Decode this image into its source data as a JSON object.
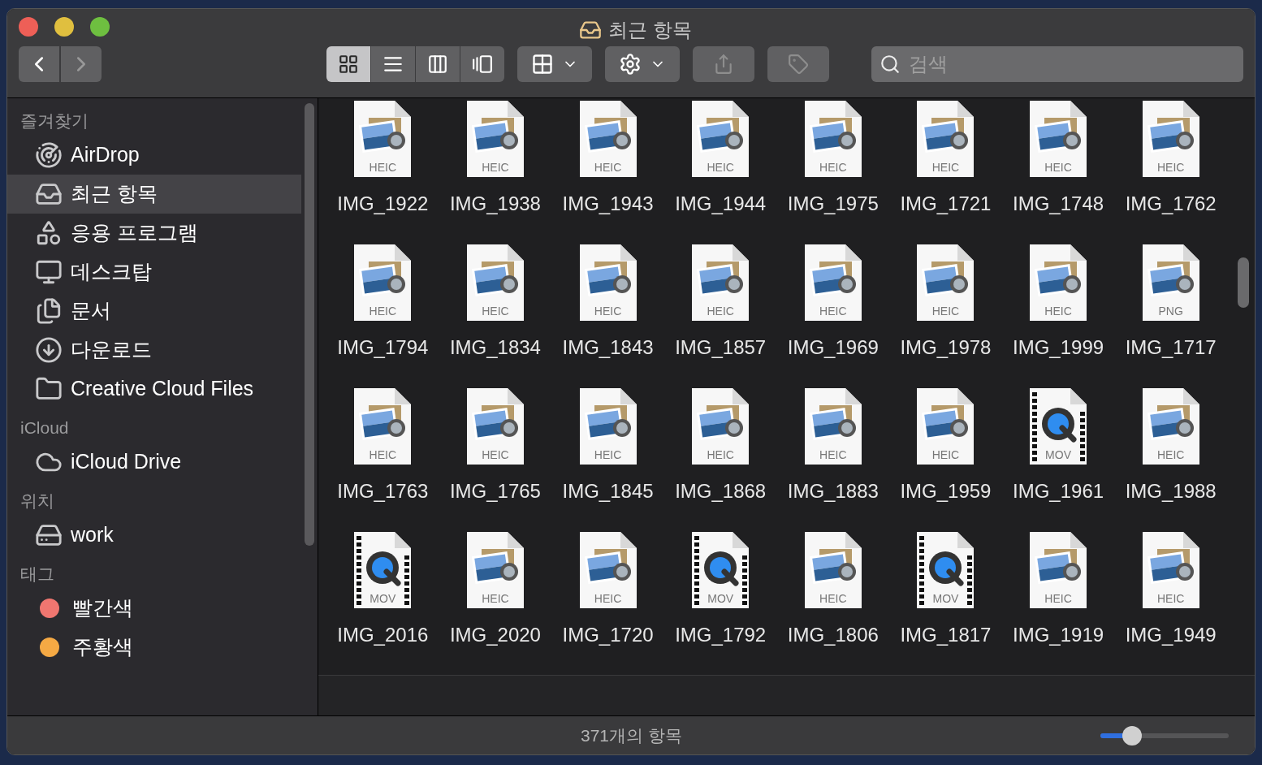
{
  "window": {
    "title": "최근 항목"
  },
  "toolbar": {
    "back": {
      "disabled": false
    },
    "forward": {
      "disabled": true
    },
    "views": [
      {
        "kind": "icons",
        "selected": true
      },
      {
        "kind": "list",
        "selected": false
      },
      {
        "kind": "columns",
        "selected": false
      },
      {
        "kind": "gallery",
        "selected": false
      }
    ],
    "share": {
      "disabled": true
    },
    "tags": {
      "disabled": true
    },
    "search": {
      "placeholder": "검색"
    }
  },
  "sidebar": [
    {
      "heading": "즐겨찾기",
      "items": [
        {
          "label": "AirDrop",
          "kind": "airdrop",
          "selected": false
        },
        {
          "label": "최근 항목",
          "kind": "recents",
          "selected": true
        },
        {
          "label": "응용 프로그램",
          "kind": "apps",
          "selected": false
        },
        {
          "label": "데스크탑",
          "kind": "desktop",
          "selected": false
        },
        {
          "label": "문서",
          "kind": "documents",
          "selected": false
        },
        {
          "label": "다운로드",
          "kind": "downloads",
          "selected": false
        },
        {
          "label": "Creative Cloud Files",
          "kind": "folder",
          "selected": false
        }
      ]
    },
    {
      "heading": "iCloud",
      "items": [
        {
          "label": "iCloud Drive",
          "kind": "cloud",
          "selected": false
        }
      ]
    },
    {
      "heading": "위치",
      "items": [
        {
          "label": "work",
          "kind": "disk",
          "selected": false
        }
      ]
    },
    {
      "heading": "태그",
      "items": [
        {
          "label": "빨간색",
          "kind": "tag",
          "color": "#f07670",
          "selected": false
        },
        {
          "label": "주황색",
          "kind": "tag",
          "color": "#f5a944",
          "selected": false
        }
      ]
    }
  ],
  "files": [
    {
      "name": "IMG_1922",
      "ext": "HEIC",
      "kind": "image"
    },
    {
      "name": "IMG_1938",
      "ext": "HEIC",
      "kind": "image"
    },
    {
      "name": "IMG_1943",
      "ext": "HEIC",
      "kind": "image"
    },
    {
      "name": "IMG_1944",
      "ext": "HEIC",
      "kind": "image"
    },
    {
      "name": "IMG_1975",
      "ext": "HEIC",
      "kind": "image"
    },
    {
      "name": "IMG_1721",
      "ext": "HEIC",
      "kind": "image"
    },
    {
      "name": "IMG_1748",
      "ext": "HEIC",
      "kind": "image"
    },
    {
      "name": "IMG_1762",
      "ext": "HEIC",
      "kind": "image"
    },
    {
      "name": "IMG_1794",
      "ext": "HEIC",
      "kind": "image"
    },
    {
      "name": "IMG_1834",
      "ext": "HEIC",
      "kind": "image"
    },
    {
      "name": "IMG_1843",
      "ext": "HEIC",
      "kind": "image"
    },
    {
      "name": "IMG_1857",
      "ext": "HEIC",
      "kind": "image"
    },
    {
      "name": "IMG_1969",
      "ext": "HEIC",
      "kind": "image"
    },
    {
      "name": "IMG_1978",
      "ext": "HEIC",
      "kind": "image"
    },
    {
      "name": "IMG_1999",
      "ext": "HEIC",
      "kind": "image"
    },
    {
      "name": "IMG_1717",
      "ext": "PNG",
      "kind": "image"
    },
    {
      "name": "IMG_1763",
      "ext": "HEIC",
      "kind": "image"
    },
    {
      "name": "IMG_1765",
      "ext": "HEIC",
      "kind": "image"
    },
    {
      "name": "IMG_1845",
      "ext": "HEIC",
      "kind": "image"
    },
    {
      "name": "IMG_1868",
      "ext": "HEIC",
      "kind": "image"
    },
    {
      "name": "IMG_1883",
      "ext": "HEIC",
      "kind": "image"
    },
    {
      "name": "IMG_1959",
      "ext": "HEIC",
      "kind": "image"
    },
    {
      "name": "IMG_1961",
      "ext": "MOV",
      "kind": "movie"
    },
    {
      "name": "IMG_1988",
      "ext": "HEIC",
      "kind": "image"
    },
    {
      "name": "IMG_2016",
      "ext": "MOV",
      "kind": "movie"
    },
    {
      "name": "IMG_2020",
      "ext": "HEIC",
      "kind": "image"
    },
    {
      "name": "IMG_1720",
      "ext": "HEIC",
      "kind": "image"
    },
    {
      "name": "IMG_1792",
      "ext": "MOV",
      "kind": "movie"
    },
    {
      "name": "IMG_1806",
      "ext": "HEIC",
      "kind": "image"
    },
    {
      "name": "IMG_1817",
      "ext": "MOV",
      "kind": "movie"
    },
    {
      "name": "IMG_1919",
      "ext": "HEIC",
      "kind": "image"
    },
    {
      "name": "IMG_1949",
      "ext": "HEIC",
      "kind": "image"
    }
  ],
  "status_bar": {
    "text": "371개의 항목",
    "zoom": {
      "level": 0.2
    }
  }
}
